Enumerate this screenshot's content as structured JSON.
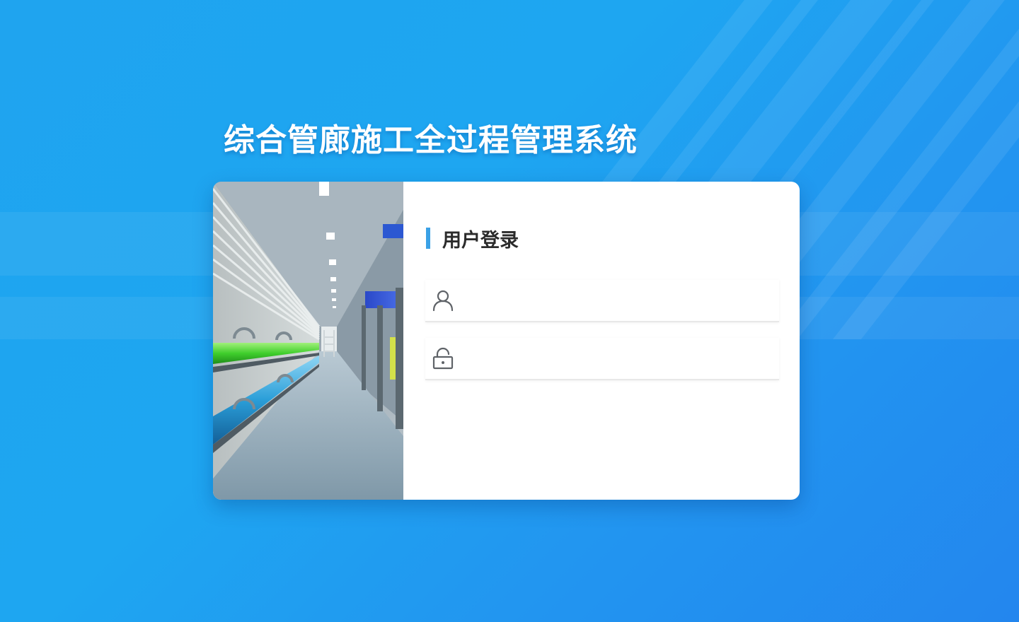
{
  "page": {
    "title": "综合管廊施工全过程管理系统"
  },
  "login": {
    "heading": "用户登录",
    "username": {
      "icon": "user-icon",
      "placeholder": "",
      "value": ""
    },
    "password": {
      "icon": "lock-icon",
      "placeholder": "",
      "value": ""
    }
  },
  "illustration": {
    "subject": "utility-tunnel-pipes-icon"
  },
  "colors": {
    "background": "#1fa4ef",
    "accent": "#3aa1e6",
    "heading": "#2b2b2b",
    "card": "#ffffff"
  }
}
